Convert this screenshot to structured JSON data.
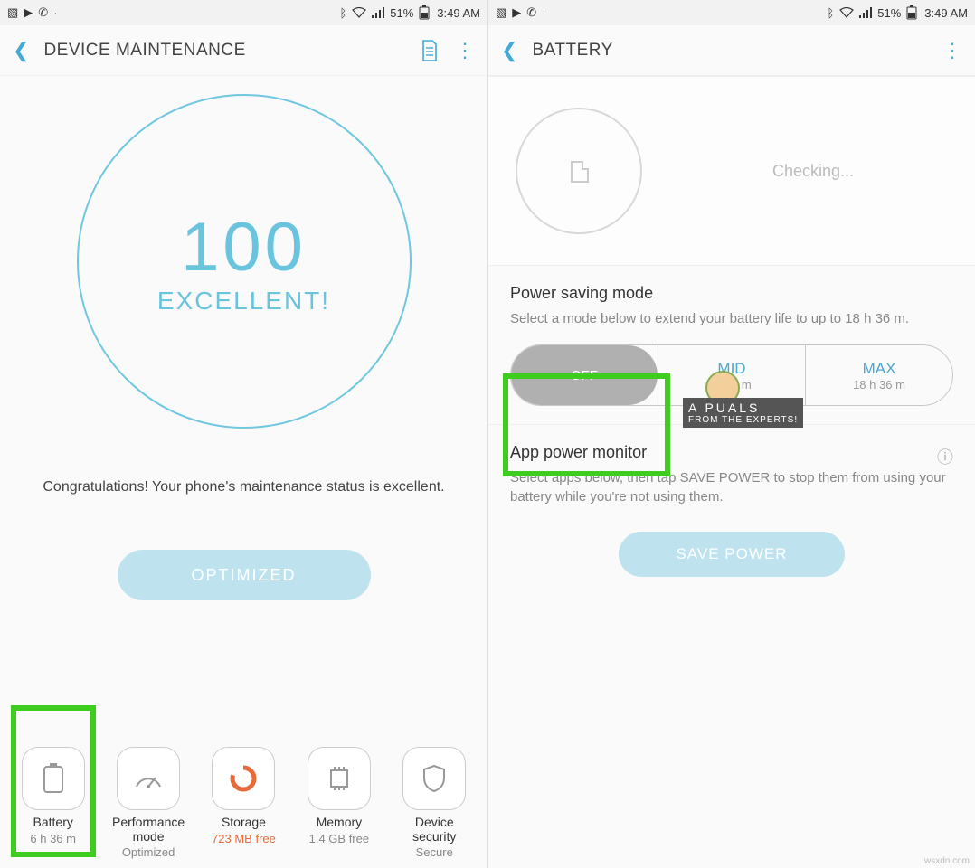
{
  "statusbar": {
    "battery_pct": "51%",
    "clock": "3:49 AM"
  },
  "left": {
    "title": "DEVICE MAINTENANCE",
    "score": "100",
    "grade": "EXCELLENT!",
    "congrats": "Congratulations! Your phone's maintenance status is excellent.",
    "optimized_btn": "OPTIMIZED",
    "tiles": [
      {
        "label": "Battery",
        "sub": "6 h 36 m"
      },
      {
        "label": "Performance mode",
        "sub": "Optimized"
      },
      {
        "label": "Storage",
        "sub": "723 MB free"
      },
      {
        "label": "Memory",
        "sub": "1.4 GB free"
      },
      {
        "label": "Device security",
        "sub": "Secure"
      }
    ]
  },
  "right": {
    "title": "BATTERY",
    "checking": "Checking...",
    "psm_title": "Power saving mode",
    "psm_desc": "Select a mode below to extend your battery life to up to 18 h 36 m.",
    "modes": {
      "off": "OFF",
      "mid": "MID",
      "mid_sub": "8 h 7 m",
      "max": "MAX",
      "max_sub": "18 h 36 m"
    },
    "apm_title": "App power monitor",
    "apm_desc": "Select apps below, then tap SAVE POWER to stop them from using your battery while you're not using them.",
    "save_power_btn": "SAVE POWER"
  },
  "badge": "FROM THE EXPERTS!",
  "badge_name": "A   PUALS",
  "watermark": "wsxdn.com"
}
